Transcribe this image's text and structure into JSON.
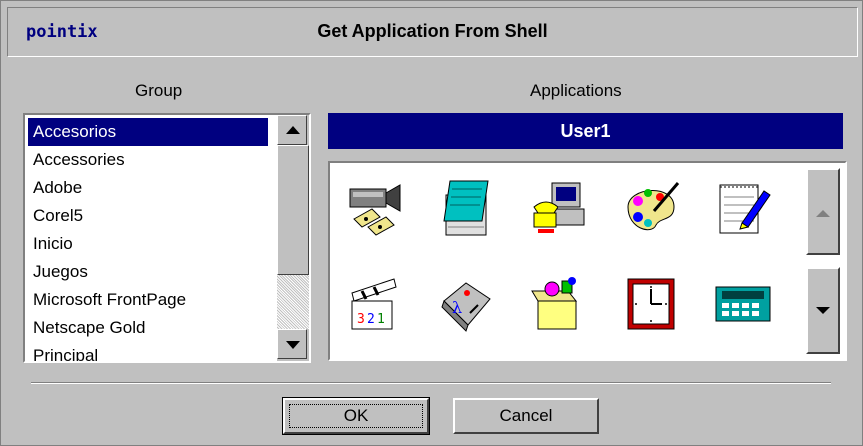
{
  "window": {
    "brand": "pointix",
    "title": "Get Application From Shell"
  },
  "group": {
    "label": "Group",
    "items": [
      "Accesorios",
      "Accessories",
      "Adobe",
      "Corel5",
      "Inicio",
      "Juegos",
      "Microsoft FrontPage",
      "Netscape Gold",
      "Principal"
    ],
    "selected": "Accesorios"
  },
  "applications": {
    "label": "Applications",
    "header": "User1",
    "icons": [
      "media-player-icon",
      "notepad-icon",
      "phone-dialer-icon",
      "paint-palette-icon",
      "write-pen-icon",
      "media-clip-icon",
      "calculator-lambda-icon",
      "package-box-icon",
      "clock-icon",
      "keyboard-calculator-icon"
    ]
  },
  "buttons": {
    "ok": "OK",
    "cancel": "Cancel"
  },
  "colors": {
    "face": "#c0c0c0",
    "selection": "#000080",
    "brand": "#000080"
  }
}
